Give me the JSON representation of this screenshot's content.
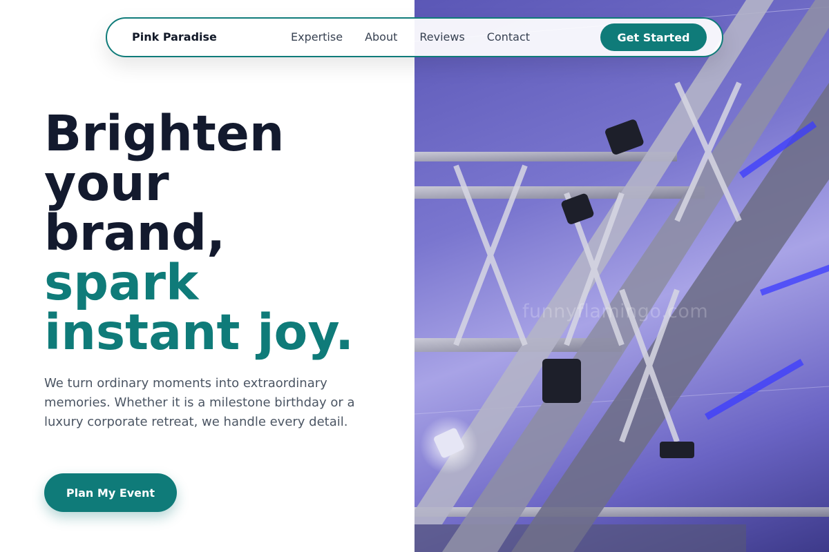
{
  "nav": {
    "brand": "Pink Paradise",
    "links": [
      "Expertise",
      "About",
      "Reviews",
      "Contact"
    ],
    "cta_label": "Get Started"
  },
  "hero": {
    "headline_lines": [
      "Brighten",
      "your",
      "brand,"
    ],
    "accent_lines": [
      "spark",
      "instant joy."
    ],
    "description": "We turn ordinary moments into extraordinary memories. Whether it is a milestone birthday or a luxury corporate retreat, we handle every detail.",
    "button_label": "Plan My Event",
    "image_watermark": "funnyflamingo.com"
  },
  "colors": {
    "accent": "#0f7b79",
    "heading": "#131a2e",
    "body_text": "#4b5563"
  }
}
